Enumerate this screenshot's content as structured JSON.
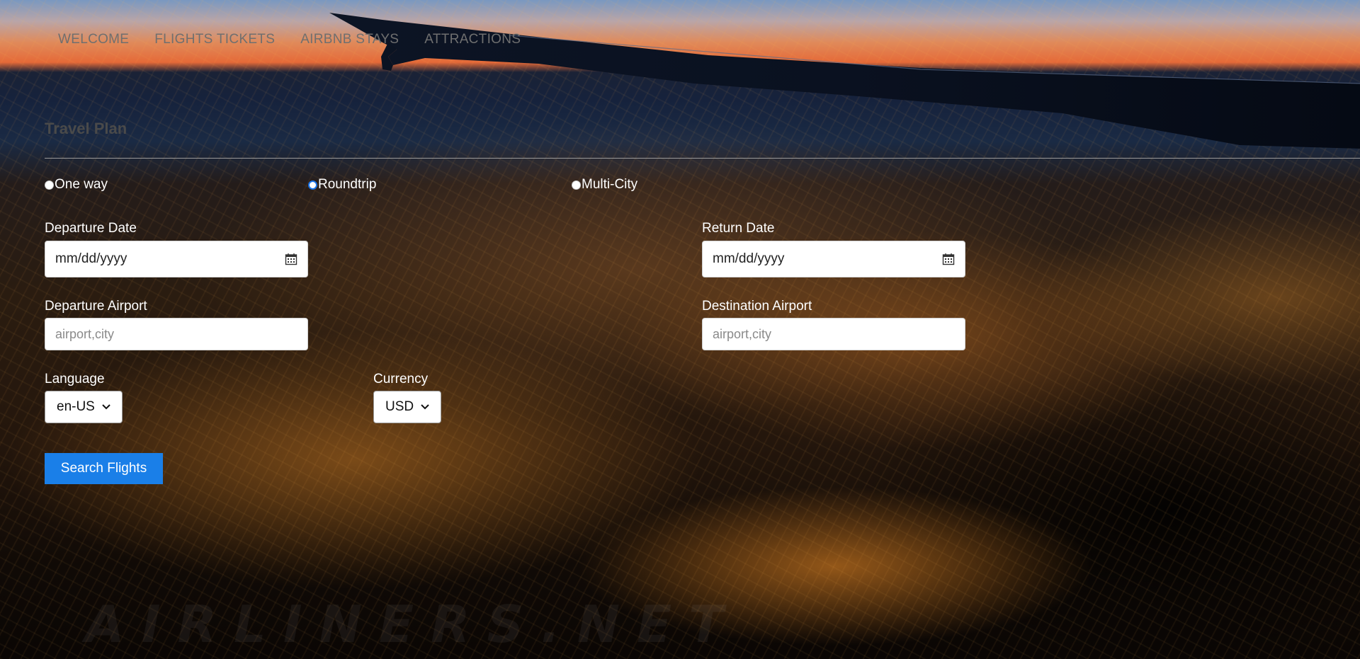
{
  "nav": {
    "items": [
      {
        "label": "WELCOME"
      },
      {
        "label": "FLIGHTS TICKETS"
      },
      {
        "label": "AIRBNB STAYS"
      },
      {
        "label": "ATTRACTIONS"
      }
    ]
  },
  "form": {
    "title": "Travel Plan",
    "trip_types": [
      {
        "label": "One way",
        "selected": false
      },
      {
        "label": "Roundtrip",
        "selected": true
      },
      {
        "label": "Multi-City",
        "selected": false
      }
    ],
    "departure_date": {
      "label": "Departure Date",
      "value": "mm/dd/yyyy"
    },
    "return_date": {
      "label": "Return Date",
      "value": "mm/dd/yyyy"
    },
    "departure_airport": {
      "label": "Departure Airport",
      "placeholder": "airport,city"
    },
    "destination_airport": {
      "label": "Destination Airport",
      "placeholder": "airport,city"
    },
    "language": {
      "label": "Language",
      "selected": "en-US"
    },
    "currency": {
      "label": "Currency",
      "selected": "USD"
    },
    "search_button": "Search Flights"
  },
  "background": {
    "description_icon": "night-city-aerial-with-plane-wing",
    "watermark": "AIRLINERS.NET"
  },
  "colors": {
    "accent": "#1a7fe8",
    "nav_text": "#6f6f6f",
    "label_text": "#ffffff"
  }
}
